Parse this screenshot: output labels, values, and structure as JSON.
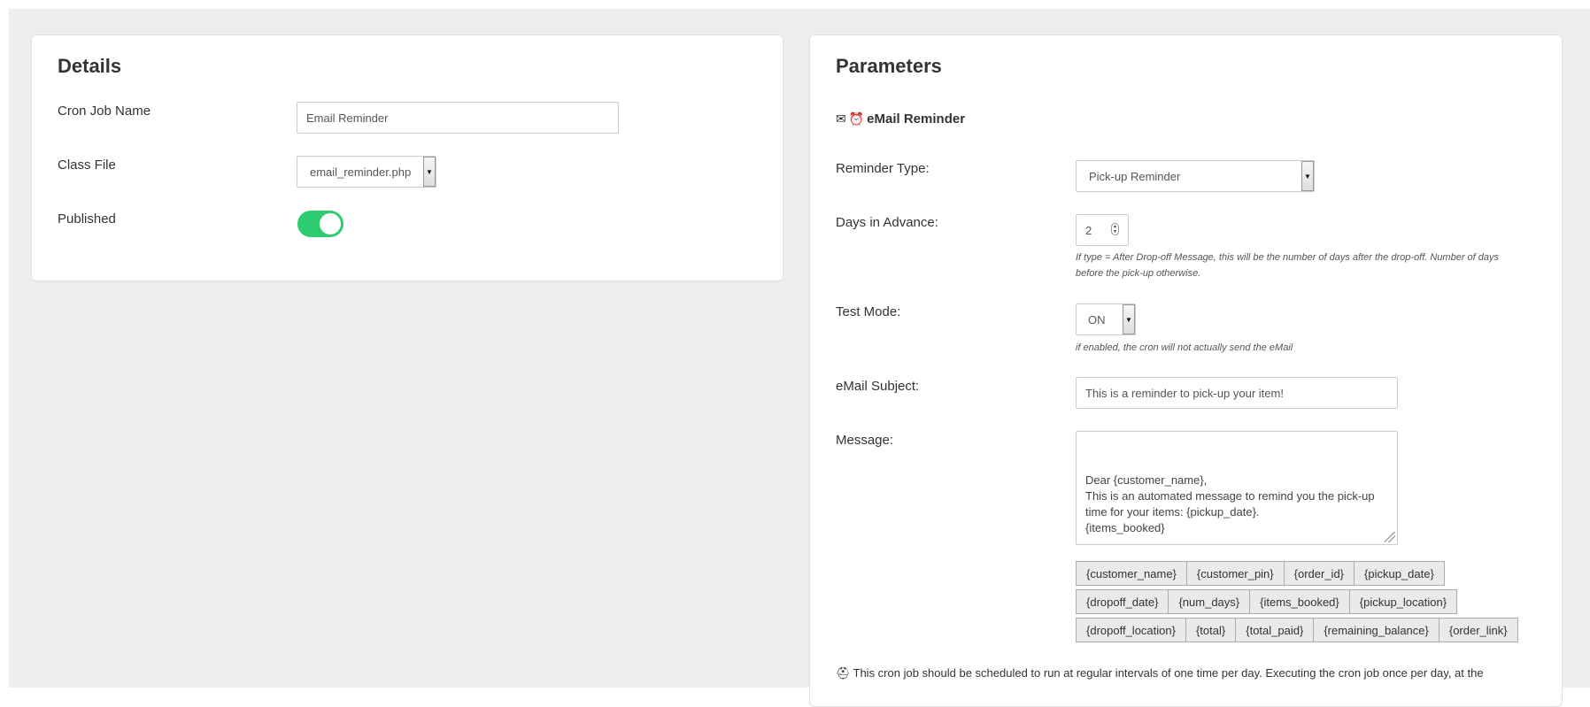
{
  "details": {
    "title": "Details",
    "cron_job_name_label": "Cron Job Name",
    "cron_job_name_value": "Email Reminder",
    "class_file_label": "Class File",
    "class_file_value": "email_reminder.php",
    "published_label": "Published",
    "published_on": true
  },
  "parameters": {
    "title": "Parameters",
    "section_icons": [
      "envelope-icon",
      "alarm-clock-icon"
    ],
    "section_heading": "eMail Reminder",
    "reminder_type_label": "Reminder Type:",
    "reminder_type_value": "Pick-up Reminder",
    "days_label": "Days in Advance:",
    "days_value": "2",
    "days_help_line1": "If type = After Drop-off Message, this will be the number of days after the drop-off. Number of days",
    "days_help_line2": "before the pick-up otherwise.",
    "test_mode_label": "Test Mode:",
    "test_mode_value": "ON",
    "test_mode_help": "if enabled, the cron will not actually send the eMail",
    "subject_label": "eMail Subject:",
    "subject_value": "This is a reminder to pick-up your item!",
    "message_label": "Message:",
    "message_value": "Dear {customer_name},\nThis is an automated message to remind you the pick-up\ntime for your items: {pickup_date}.\n{items_booked}",
    "tag_rows": [
      [
        "{customer_name}",
        "{customer_pin}",
        "{order_id}",
        "{pickup_date}"
      ],
      [
        "{dropoff_date}",
        "{num_days}",
        "{items_booked}",
        "{pickup_location}"
      ],
      [
        "{dropoff_location}",
        "{total}",
        "{total_paid}",
        "{remaining_balance}",
        "{order_link}"
      ]
    ],
    "footer_icon": "lifebuoy-icon",
    "footer_note": "This cron job should be scheduled to run at regular intervals of one time per day. Executing the cron job once per day, at the"
  },
  "colors": {
    "toggle_on": "#2ecc71",
    "background": "#eeeeee",
    "card": "#ffffff"
  }
}
